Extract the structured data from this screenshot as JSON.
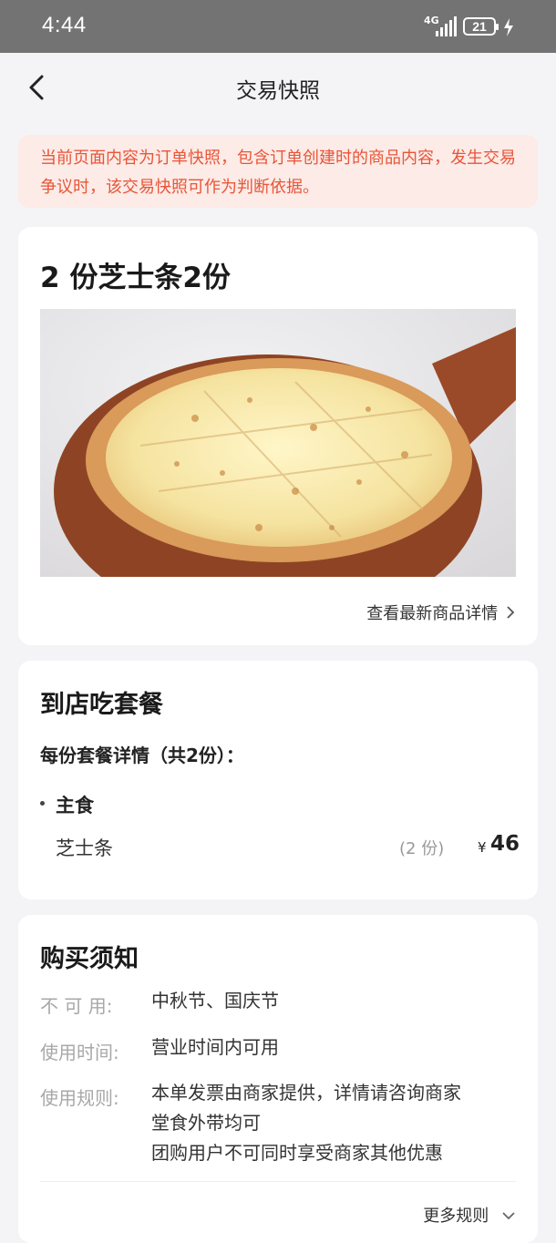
{
  "status_bar": {
    "time": "4:44",
    "network": "4G",
    "battery": "21"
  },
  "nav": {
    "title": "交易快照"
  },
  "notice": {
    "text": "当前页面内容为订单快照，包含订单创建时的商品内容，发生交易争议时，该交易快照可作为判断依据。"
  },
  "product": {
    "title": "2 份芝士条2份",
    "image_icon": "cheese-pizza-image",
    "detail_link": "查看最新商品详情"
  },
  "package": {
    "title": "到店吃套餐",
    "subtitle": "每份套餐详情（共2份）：",
    "category": "主食",
    "item_name": "芝士条",
    "item_qty": "(2 份)",
    "currency": "¥",
    "item_price": "46"
  },
  "notes": {
    "title": "购买须知",
    "rows": [
      {
        "label": "不 可 用:",
        "value": "中秋节、国庆节"
      },
      {
        "label": "使用时间:",
        "value": "营业时间内可用"
      },
      {
        "label": "使用规则:",
        "lines": [
          "本单发票由商家提供，详情请咨询商家",
          "堂食外带均可",
          "团购用户不可同时享受商家其他优惠"
        ]
      }
    ],
    "more": "更多规则"
  },
  "colors": {
    "accent": "#e8553a",
    "notice_bg": "#fcebe6"
  }
}
